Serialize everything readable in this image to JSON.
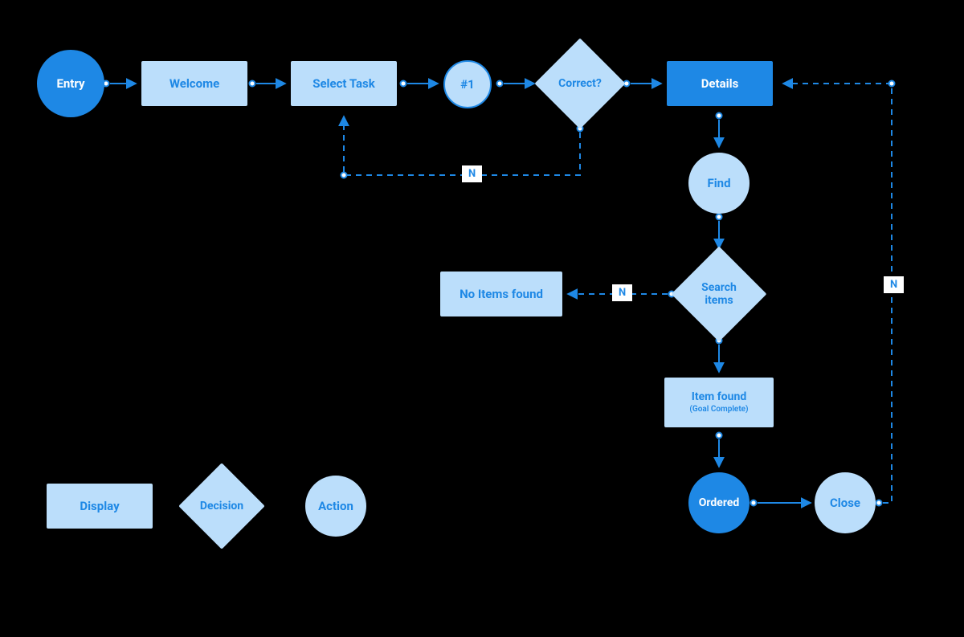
{
  "nodes": {
    "entry": {
      "label": "Entry"
    },
    "welcome": {
      "label": "Welcome"
    },
    "select_task": {
      "label": "Select Task"
    },
    "hash1": {
      "label": "#1"
    },
    "correct": {
      "label": "Correct?"
    },
    "details": {
      "label": "Details"
    },
    "find": {
      "label": "Find"
    },
    "search": {
      "label": "Search items"
    },
    "no_items": {
      "label": "No Items found"
    },
    "item_found": {
      "label": "Item found",
      "sublabel": "(Goal Complete)"
    },
    "ordered": {
      "label": "Ordered"
    },
    "close": {
      "label": "Close"
    }
  },
  "edge_labels": {
    "correct_no": "N",
    "search_no": "N",
    "close_no": "N"
  },
  "legend": {
    "display": "Display",
    "decision": "Decision",
    "action": "Action"
  },
  "colors": {
    "light": "#bbdefb",
    "dark": "#1e88e5",
    "bg": "#000000"
  },
  "chart_data": {
    "type": "flowchart",
    "nodes": [
      {
        "id": "entry",
        "label": "Entry",
        "shape": "circle",
        "style": "dark"
      },
      {
        "id": "welcome",
        "label": "Welcome",
        "shape": "rect",
        "style": "light"
      },
      {
        "id": "select_task",
        "label": "Select Task",
        "shape": "rect",
        "style": "light"
      },
      {
        "id": "hash1",
        "label": "#1",
        "shape": "circle",
        "style": "outline"
      },
      {
        "id": "correct",
        "label": "Correct?",
        "shape": "diamond",
        "style": "light"
      },
      {
        "id": "details",
        "label": "Details",
        "shape": "rect",
        "style": "dark"
      },
      {
        "id": "find",
        "label": "Find",
        "shape": "circle",
        "style": "light"
      },
      {
        "id": "search",
        "label": "Search items",
        "shape": "diamond",
        "style": "light"
      },
      {
        "id": "no_items",
        "label": "No Items found",
        "shape": "rect",
        "style": "light"
      },
      {
        "id": "item_found",
        "label": "Item found",
        "sublabel": "(Goal Complete)",
        "shape": "rect",
        "style": "light"
      },
      {
        "id": "ordered",
        "label": "Ordered",
        "shape": "circle",
        "style": "dark"
      },
      {
        "id": "close",
        "label": "Close",
        "shape": "circle",
        "style": "light"
      }
    ],
    "edges": [
      {
        "from": "entry",
        "to": "welcome",
        "style": "solid"
      },
      {
        "from": "welcome",
        "to": "select_task",
        "style": "solid"
      },
      {
        "from": "select_task",
        "to": "hash1",
        "style": "solid"
      },
      {
        "from": "hash1",
        "to": "correct",
        "style": "solid"
      },
      {
        "from": "correct",
        "to": "details",
        "style": "solid"
      },
      {
        "from": "correct",
        "to": "select_task",
        "style": "dashed",
        "label": "N"
      },
      {
        "from": "details",
        "to": "find",
        "style": "solid"
      },
      {
        "from": "find",
        "to": "search",
        "style": "solid"
      },
      {
        "from": "search",
        "to": "no_items",
        "style": "dashed",
        "label": "N"
      },
      {
        "from": "search",
        "to": "item_found",
        "style": "solid"
      },
      {
        "from": "item_found",
        "to": "ordered",
        "style": "solid"
      },
      {
        "from": "ordered",
        "to": "close",
        "style": "solid"
      },
      {
        "from": "close",
        "to": "details",
        "style": "dashed",
        "label": "N"
      }
    ],
    "legend": [
      {
        "shape": "rect",
        "label": "Display"
      },
      {
        "shape": "diamond",
        "label": "Decision"
      },
      {
        "shape": "circle",
        "label": "Action"
      }
    ]
  }
}
